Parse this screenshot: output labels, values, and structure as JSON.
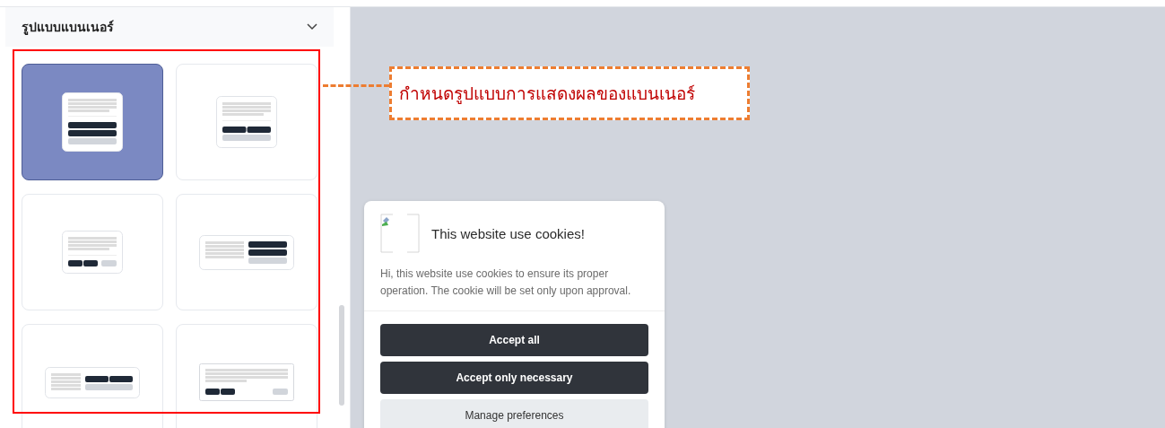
{
  "panel": {
    "title": "รูปแบบแบนเนอร์",
    "expanded": true
  },
  "layouts": [
    {
      "kind": "box",
      "selected": true
    },
    {
      "kind": "box-compact",
      "selected": false
    },
    {
      "kind": "box-inline",
      "selected": false
    },
    {
      "kind": "bar-split",
      "selected": false
    },
    {
      "kind": "bar-inline",
      "selected": false
    },
    {
      "kind": "bar-full",
      "selected": false
    }
  ],
  "annotation": {
    "text": "กำหนดรูปแบบการแสดงผลของแบนเนอร์"
  },
  "cookie_banner": {
    "title": "This website use cookies!",
    "body": "Hi, this website use cookies to ensure its proper operation. The cookie will be set only upon approval.",
    "buttons": [
      {
        "label": "Accept all",
        "kind": "primary"
      },
      {
        "label": "Accept only necessary",
        "kind": "primary"
      },
      {
        "label": "Manage preferences",
        "kind": "secondary"
      }
    ]
  }
}
